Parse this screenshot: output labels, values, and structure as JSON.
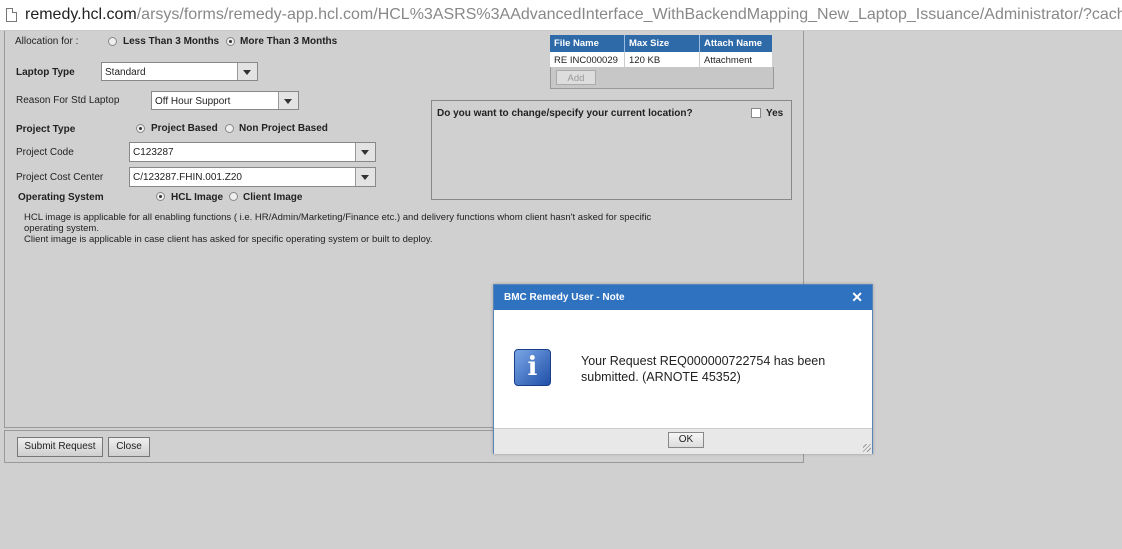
{
  "browser": {
    "url_host": "remedy.hcl.com",
    "url_path": "/arsys/forms/remedy-app.hcl.com/HCL%3ASRS%3AAdvancedInterface_WithBackendMapping_New_Laptop_Issuance/Administrator/?cacheid"
  },
  "form": {
    "allocation": {
      "label": "Allocation for :",
      "option1": "Less Than 3 Months",
      "option2": "More Than 3 Months",
      "selected": "More Than 3 Months"
    },
    "laptop_type": {
      "label": "Laptop Type",
      "value": "Standard"
    },
    "reason": {
      "label": "Reason For Std Laptop",
      "value": "Off Hour Support"
    },
    "project_type": {
      "label": "Project Type",
      "option1": "Project Based",
      "option2": "Non Project Based",
      "selected": "Project Based"
    },
    "project_code": {
      "label": "Project Code",
      "value": "C123287"
    },
    "cost_center": {
      "label": "Project Cost Center",
      "value": "C/123287.FHIN.001.Z20"
    },
    "os": {
      "label": "Operating System",
      "option1": "HCL Image",
      "option2": "Client Image",
      "selected": "HCL Image"
    },
    "note_line1": "HCL image is applicable for all enabling  functions ( i.e. HR/Admin/Marketing/Finance etc.) and delivery functions whom client hasn't asked for specific",
    "note_line2": "operating system.",
    "note_line3": "Client image is applicable in case client has asked for specific operating system or built to deploy.",
    "location": {
      "question": "Do you want to change/specify your current location?",
      "checkbox_label": "Yes"
    },
    "attachments": {
      "headers": [
        "File Name",
        "Max Size",
        "Attach Name"
      ],
      "row": [
        "RE INC000029",
        "120 KB",
        "Attachment"
      ],
      "add_label": "Add"
    }
  },
  "actions": {
    "submit_label": "Submit Request",
    "close_label": "Close"
  },
  "dialog": {
    "title": "BMC Remedy User - Note",
    "close_glyph": "✕",
    "icon": "info-icon",
    "icon_glyph": "i",
    "message_line1": "Your Request REQ000000722754 has been",
    "message_line2": "submitted. (ARNOTE 45352)",
    "ok_label": "OK"
  },
  "colors": {
    "dialog_title_bg": "#2f72c0",
    "table_header_bg": "#2e6aa8",
    "page_bg": "#d0d0d0"
  }
}
